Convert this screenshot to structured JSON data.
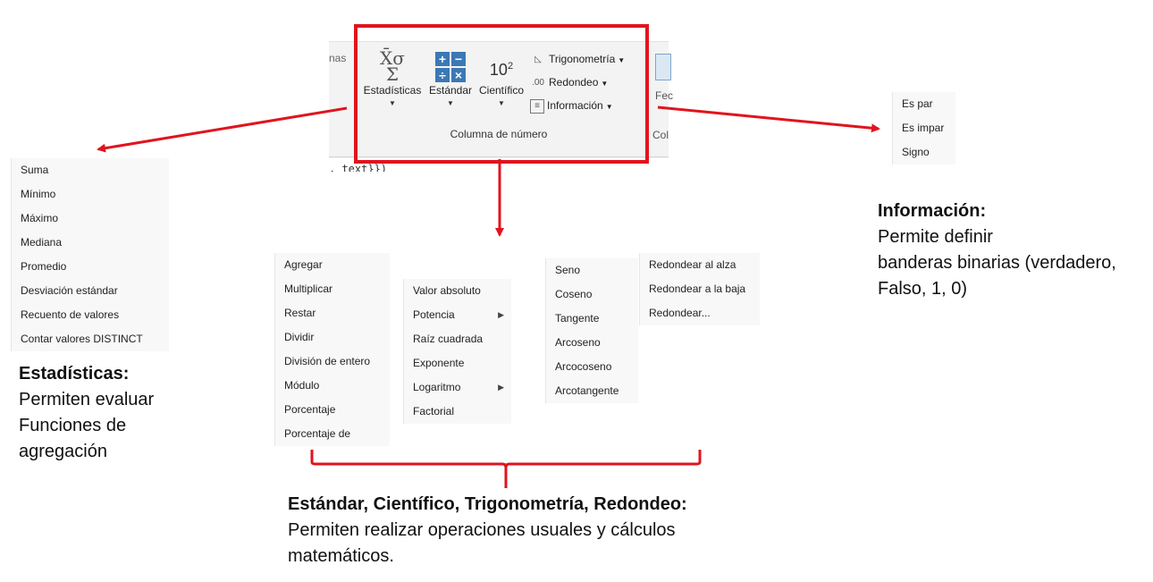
{
  "ribbon": {
    "left_partial_text": "nas",
    "buttons": {
      "estadisticas": "Estadísticas",
      "estandar": "Estándar",
      "cientifico": "Científico",
      "cientifico_icon_base": "10",
      "cientifico_icon_exp": "2"
    },
    "small_buttons": {
      "trigonometria": "Trigonometría",
      "redondeo": "Redondeo",
      "informacion": "Información"
    },
    "group_label": "Columna de número",
    "right_partial_top": "Fec",
    "right_partial_bottom": "Col",
    "code_fragment": ", text}})"
  },
  "menus": {
    "estadisticas": [
      "Suma",
      "Mínimo",
      "Máximo",
      "Mediana",
      "Promedio",
      "Desviación estándar",
      "Recuento de valores",
      "Contar valores DISTINCT"
    ],
    "estandar": [
      "Agregar",
      "Multiplicar",
      "Restar",
      "Dividir",
      "División de entero",
      "Módulo",
      "Porcentaje",
      "Porcentaje de"
    ],
    "cientifico": [
      {
        "label": "Valor absoluto",
        "submenu": false
      },
      {
        "label": "Potencia",
        "submenu": true
      },
      {
        "label": "Raíz cuadrada",
        "submenu": false
      },
      {
        "label": "Exponente",
        "submenu": false
      },
      {
        "label": "Logaritmo",
        "submenu": true
      },
      {
        "label": "Factorial",
        "submenu": false
      }
    ],
    "trigonometria": [
      "Seno",
      "Coseno",
      "Tangente",
      "Arcoseno",
      "Arcocoseno",
      "Arcotangente"
    ],
    "redondeo": [
      "Redondear al alza",
      "Redondear a la baja",
      "Redondear..."
    ],
    "informacion": [
      "Es par",
      "Es impar",
      "Signo"
    ]
  },
  "notes": {
    "estadisticas": {
      "title": "Estadísticas:",
      "text": "Permiten evaluar\nFunciones de\nagregación"
    },
    "informacion": {
      "title": "Información:",
      "text": "Permite definir\nbanderas binarias (verdadero,\nFalso, 1, 0)"
    },
    "estandar": {
      "title": "Estándar, Científico, Trigonometría, Redondeo:",
      "text": "Permiten realizar operaciones usuales y cálculos\nmatemáticos."
    }
  },
  "colors": {
    "highlight": "#e0141e",
    "ribbon_bg": "#f3f3f3",
    "menu_bg": "#f8f8f8",
    "icon_blue": "#3c78b4"
  }
}
